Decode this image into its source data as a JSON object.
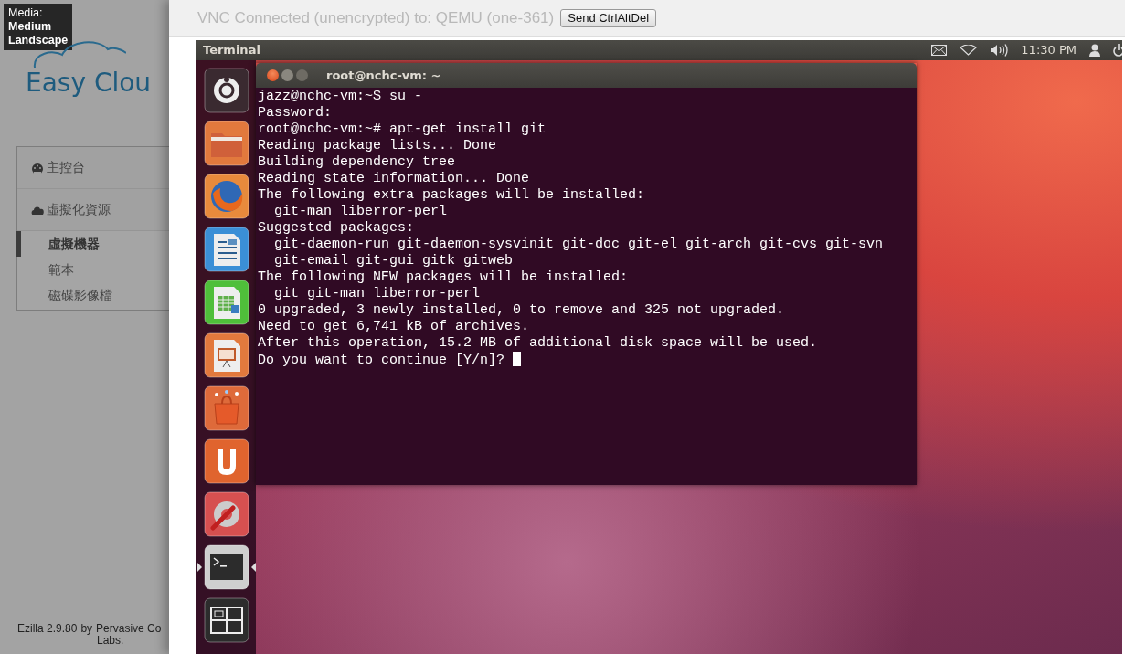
{
  "media_badge": {
    "label": "Media:",
    "lines": [
      "Medium",
      "Landscape"
    ]
  },
  "logo": {
    "text": "Easy Clou"
  },
  "sidebar": {
    "sections": [
      {
        "label": "主控台"
      },
      {
        "label": "虛擬化資源",
        "children": [
          {
            "label": "虛擬機器",
            "selected": true
          },
          {
            "label": "範本",
            "selected": false
          },
          {
            "label": "磁碟影像檔",
            "selected": false
          }
        ]
      }
    ]
  },
  "footer": {
    "product": "Ezilla 2.9.80",
    "by": "by",
    "org_lines": [
      "Pervasive Co",
      "Labs"
    ],
    "period": "."
  },
  "vnc": {
    "status": "VNC Connected (unencrypted) to: QEMU (one-361)",
    "button": "Send CtrlAltDel"
  },
  "desktop": {
    "panel_title": "Terminal",
    "clock": "11:30 PM",
    "launcher": [
      {
        "kind": "ubuntu",
        "active": false
      },
      {
        "kind": "folder",
        "active": false
      },
      {
        "kind": "browser",
        "active": false
      },
      {
        "kind": "writer",
        "active": false
      },
      {
        "kind": "calc",
        "active": false
      },
      {
        "kind": "impress",
        "active": false
      },
      {
        "kind": "store",
        "active": false
      },
      {
        "kind": "update",
        "active": false
      },
      {
        "kind": "settings",
        "active": false
      },
      {
        "kind": "terminal",
        "active": true
      },
      {
        "kind": "workspaces",
        "active": false
      }
    ],
    "terminal": {
      "title": "root@nchc-vm: ~",
      "cursor": true,
      "lines": [
        "jazz@nchc-vm:~$ su -",
        "Password:",
        "root@nchc-vm:~# apt-get install git",
        "Reading package lists... Done",
        "Building dependency tree",
        "Reading state information... Done",
        "The following extra packages will be installed:",
        "  git-man liberror-perl",
        "Suggested packages:",
        "  git-daemon-run git-daemon-sysvinit git-doc git-el git-arch git-cvs git-svn",
        "  git-email git-gui gitk gitweb",
        "The following NEW packages will be installed:",
        "  git git-man liberror-perl",
        "0 upgraded, 3 newly installed, 0 to remove and 325 not upgraded.",
        "Need to get 6,741 kB of archives.",
        "After this operation, 15.2 MB of additional disk space will be used.",
        "Do you want to continue [Y/n]? "
      ]
    }
  }
}
